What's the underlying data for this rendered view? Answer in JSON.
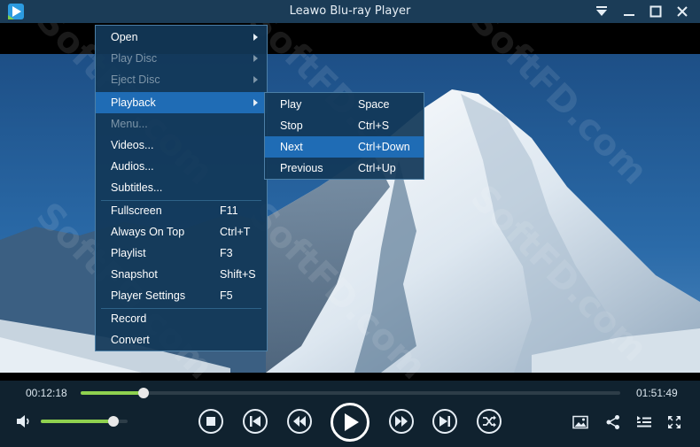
{
  "window": {
    "title": "Leawo Blu-ray Player"
  },
  "playback": {
    "elapsed": "00:12:18",
    "total": "01:51:49",
    "progress": 0.117,
    "volume": 0.84
  },
  "main_menu": {
    "items": [
      {
        "label": "Open",
        "shortcut": "",
        "submenu": true,
        "disabled": false
      },
      {
        "label": "Play Disc",
        "shortcut": "",
        "submenu": true,
        "disabled": true
      },
      {
        "label": "Eject Disc",
        "shortcut": "",
        "submenu": true,
        "disabled": true
      },
      {
        "label": "Playback",
        "shortcut": "",
        "submenu": true,
        "disabled": false,
        "highlighted": true
      },
      {
        "label": "Menu...",
        "shortcut": "",
        "submenu": false,
        "disabled": true
      },
      {
        "label": "Videos...",
        "shortcut": "",
        "submenu": false,
        "disabled": false
      },
      {
        "label": "Audios...",
        "shortcut": "",
        "submenu": false,
        "disabled": false
      },
      {
        "label": "Subtitles...",
        "shortcut": "",
        "submenu": false,
        "disabled": false
      },
      {
        "label": "Fullscreen",
        "shortcut": "F11",
        "submenu": false,
        "disabled": false
      },
      {
        "label": "Always On Top",
        "shortcut": "Ctrl+T",
        "submenu": false,
        "disabled": false
      },
      {
        "label": "Playlist",
        "shortcut": "F3",
        "submenu": false,
        "disabled": false
      },
      {
        "label": "Snapshot",
        "shortcut": "Shift+S",
        "submenu": false,
        "disabled": false
      },
      {
        "label": "Player Settings",
        "shortcut": "F5",
        "submenu": false,
        "disabled": false
      },
      {
        "label": "Record",
        "shortcut": "",
        "submenu": false,
        "disabled": false
      },
      {
        "label": "Convert",
        "shortcut": "",
        "submenu": false,
        "disabled": false
      }
    ]
  },
  "playback_menu": {
    "items": [
      {
        "label": "Play",
        "shortcut": "Space"
      },
      {
        "label": "Stop",
        "shortcut": "Ctrl+S"
      },
      {
        "label": "Next",
        "shortcut": "Ctrl+Down",
        "highlighted": true
      },
      {
        "label": "Previous",
        "shortcut": "Ctrl+Up"
      }
    ]
  },
  "watermark": "SoftFD.com",
  "colors": {
    "title_bar": "#1b3c57",
    "menu_bg": "#123858",
    "menu_highlight": "#1f6cb5",
    "progress_fill": "#8fd14f",
    "control_bar": "#10222f"
  },
  "icons": {
    "app": "leawo-logo-icon",
    "title_menu": "dropdown-menu-icon",
    "minimize": "minimize-icon",
    "maximize": "maximize-icon",
    "close": "close-icon",
    "volume": "speaker-icon",
    "stop": "stop-icon",
    "previous": "skip-previous-icon",
    "rewind": "rewind-icon",
    "play": "play-icon",
    "forward": "fast-forward-icon",
    "next": "skip-next-icon",
    "shuffle": "shuffle-icon",
    "snapshot": "image-icon",
    "share": "share-icon",
    "playlist": "playlist-icon",
    "fullscreen": "fullscreen-icon"
  }
}
